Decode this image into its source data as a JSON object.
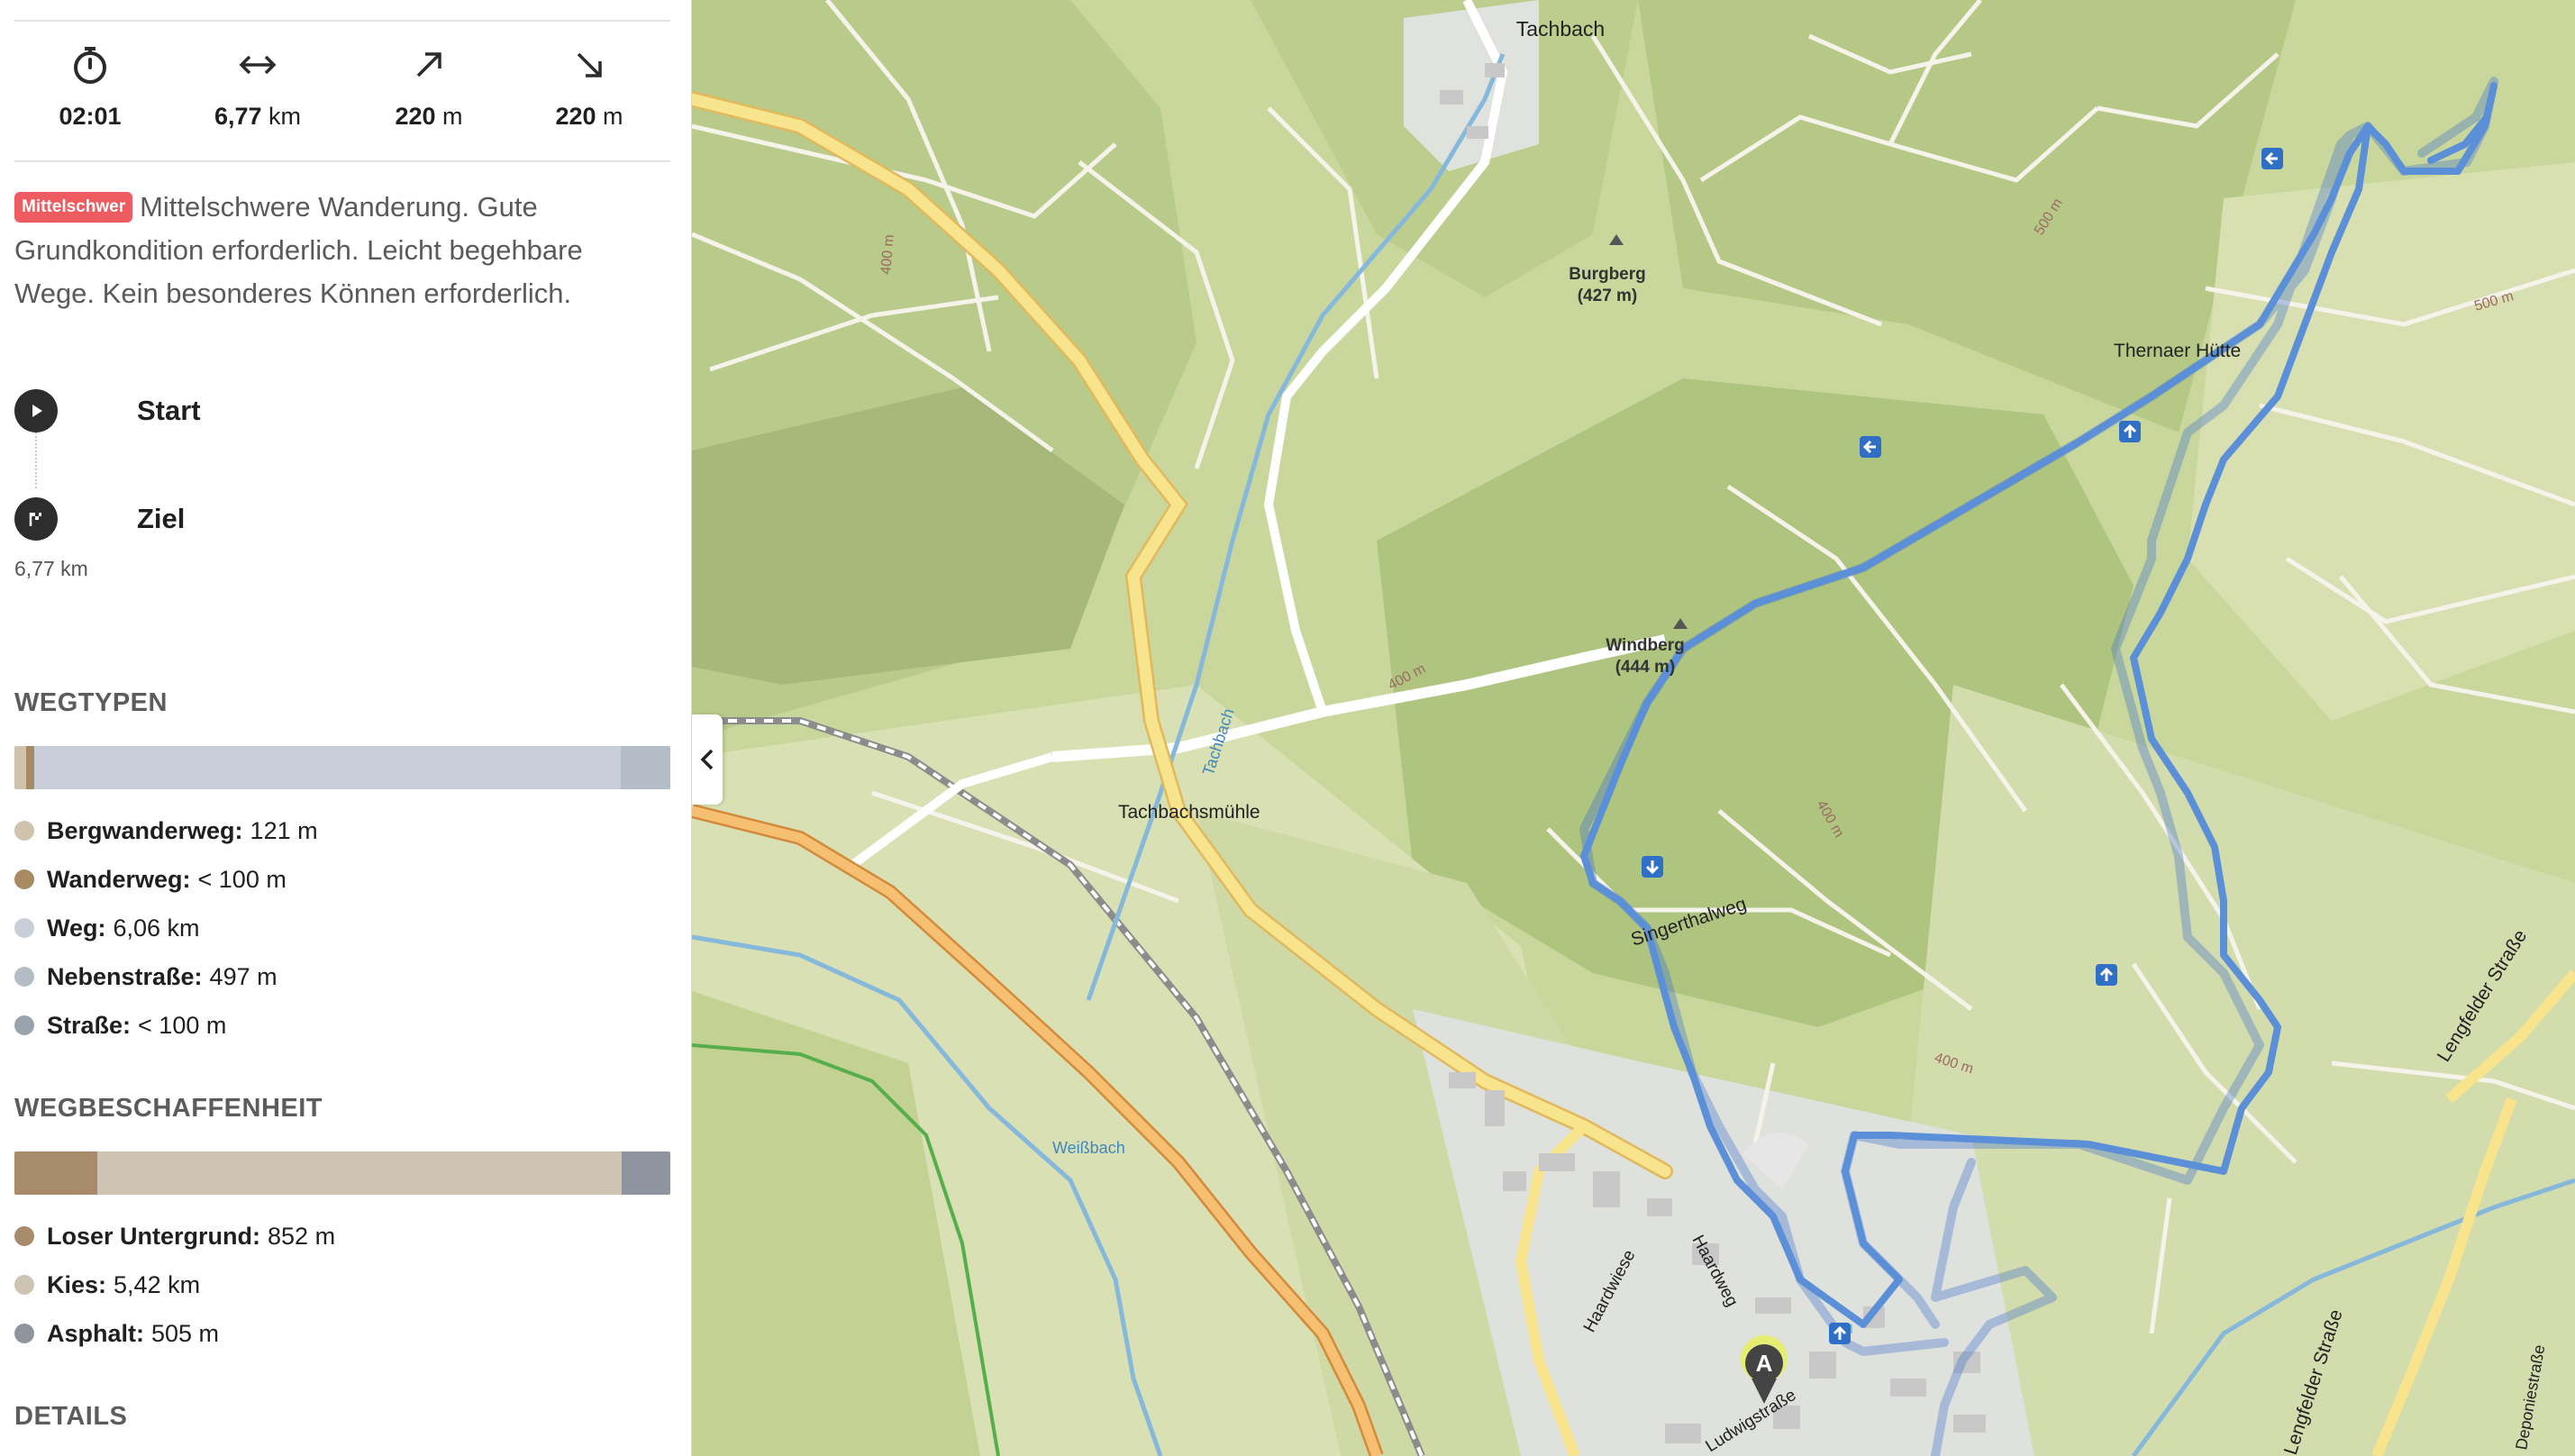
{
  "stats": [
    {
      "icon": "stopwatch-icon",
      "value": "02:01",
      "unit": ""
    },
    {
      "icon": "horizontal-arrows-icon",
      "value": "6,77",
      "unit": "km"
    },
    {
      "icon": "arrow-up-right-icon",
      "value": "220",
      "unit": "m"
    },
    {
      "icon": "arrow-down-right-icon",
      "value": "220",
      "unit": "m"
    }
  ],
  "difficulty": {
    "badge": "Mittelschwer",
    "badge_color": "#ee5b60",
    "text": "Mittelschwere Wanderung. Gute Grundkondition erforderlich. Leicht begehbare Wege. Kein besonderes Können erforderlich."
  },
  "waypoints": {
    "start": "Start",
    "ziel": "Ziel",
    "ziel_distance": "6,77 km"
  },
  "wegtypen": {
    "title": "WEGTYPEN",
    "segments": [
      {
        "color": "#cfc3ae",
        "fraction": 0.018
      },
      {
        "color": "#a88b62",
        "fraction": 0.012
      },
      {
        "color": "#c9cfd8",
        "fraction": 0.895
      },
      {
        "color": "#b4bcc6",
        "fraction": 0.075
      }
    ],
    "items": [
      {
        "label": "Bergwanderweg:",
        "value": "121 m",
        "color": "#cfc3ae"
      },
      {
        "label": "Wanderweg:",
        "value": "< 100 m",
        "color": "#a88b62"
      },
      {
        "label": "Weg:",
        "value": "6,06 km",
        "color": "#c9cfd8"
      },
      {
        "label": "Nebenstraße:",
        "value": "497 m",
        "color": "#b4bcc6"
      },
      {
        "label": "Straße:",
        "value": "< 100 m",
        "color": "#98a3ae"
      }
    ]
  },
  "wegbeschaffenheit": {
    "title": "WEGBESCHAFFENHEIT",
    "segments": [
      {
        "color": "#a88b6b",
        "fraction": 0.126
      },
      {
        "color": "#cec4b4",
        "fraction": 0.8
      },
      {
        "color": "#8f959f",
        "fraction": 0.074
      }
    ],
    "items": [
      {
        "label": "Loser Untergrund:",
        "value": "852 m",
        "color": "#a88b6b"
      },
      {
        "label": "Kies:",
        "value": "5,42 km",
        "color": "#cec4b4"
      },
      {
        "label": "Asphalt:",
        "value": "505 m",
        "color": "#8f959f"
      }
    ]
  },
  "details": {
    "title": "DETAILS"
  },
  "map": {
    "collapse_icon": "chevron-left-icon",
    "route_color": "#5b8fd8",
    "labels": {
      "tachbach": "Tachbach",
      "burgberg": "Burgberg",
      "burgberg_h": "(427 m)",
      "windberg": "Windberg",
      "windberg_h": "(444 m)",
      "thernaer": "Thernaer Hütte",
      "tachbachsmuehle": "Tachbachsmühle",
      "singerthalweg": "Singerthalweg",
      "weissbach": "Weißbach",
      "tachbach_stream": "Tachbach",
      "haardwiese": "Haardwiese",
      "haardweg": "Haardweg",
      "lengfelder1": "Lengfelder Straße",
      "lengfelder2": "Lengfelder Straße",
      "deponiestrasse": "Deponiestraße",
      "ludwig": "Ludwigstraße",
      "c400a": "400 m",
      "c400b": "400 m",
      "c400c": "400 m",
      "c400d": "400 m",
      "c500a": "500 m",
      "c500b": "500 m",
      "start_marker": "A"
    }
  }
}
